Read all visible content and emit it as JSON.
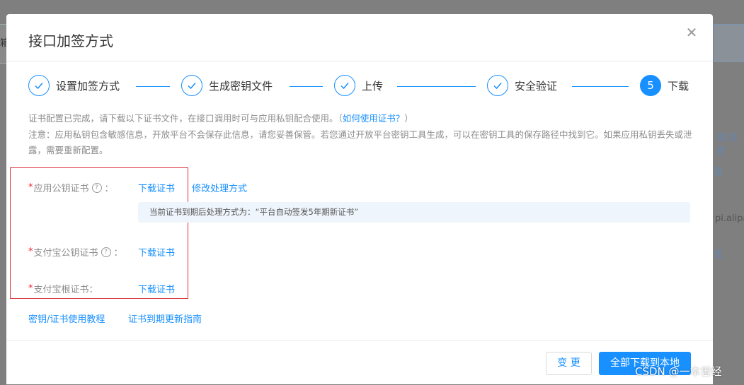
{
  "background": {
    "left_fragment": "箱",
    "right_fragments": [
      "置/查看",
      "置",
      "pi.alipay.c",
      "置"
    ]
  },
  "modal": {
    "title": "接口加签方式",
    "close_icon": "close-icon"
  },
  "steps": [
    {
      "label": "设置加签方式",
      "status": "done",
      "icon": "check-icon"
    },
    {
      "label": "生成密钥文件",
      "status": "done",
      "icon": "check-icon"
    },
    {
      "label": "上传",
      "status": "done",
      "icon": "check-icon"
    },
    {
      "label": "安全验证",
      "status": "done",
      "icon": "check-icon"
    },
    {
      "label": "下载",
      "status": "active",
      "number": "5"
    }
  ],
  "notice": {
    "line1": "证书配置已完成，请下载以下证书文件，在接口调用时可与应用私钥配合使用。（",
    "line1_link": "如何使用证书？",
    "line1_end": "）",
    "line2": "注意：应用私钥包含敏感信息，开放平台不会保存此信息，请您妥善保管。若您通过开放平台密钥工具生成，可以在密钥工具的保存路径中找到它。如果应用私钥丢失或泄露，需要重新配置。"
  },
  "fields": {
    "app_cert_label": "应用公钥证书",
    "app_cert_download": "下载证书",
    "app_cert_modify": "修改处理方式",
    "app_cert_info": "当前证书到期后处理方式为：“平台自动签发5年期新证书”",
    "alipay_cert_label": "支付宝公钥证书",
    "alipay_cert_download": "下载证书",
    "root_cert_label": "支付宝根证书：",
    "root_cert_download": "下载证书",
    "colon": "："
  },
  "links": {
    "tutorial": "密钥/证书使用教程",
    "renew_guide": "证书到期更新指南"
  },
  "footer": {
    "change_label": "变 更",
    "download_all_label": "全部下载到本地"
  },
  "watermark": "CSDN @一本曾经",
  "colors": {
    "accent": "#1890ff",
    "required": "#f5222d",
    "highlight_box": "#d9363e"
  }
}
